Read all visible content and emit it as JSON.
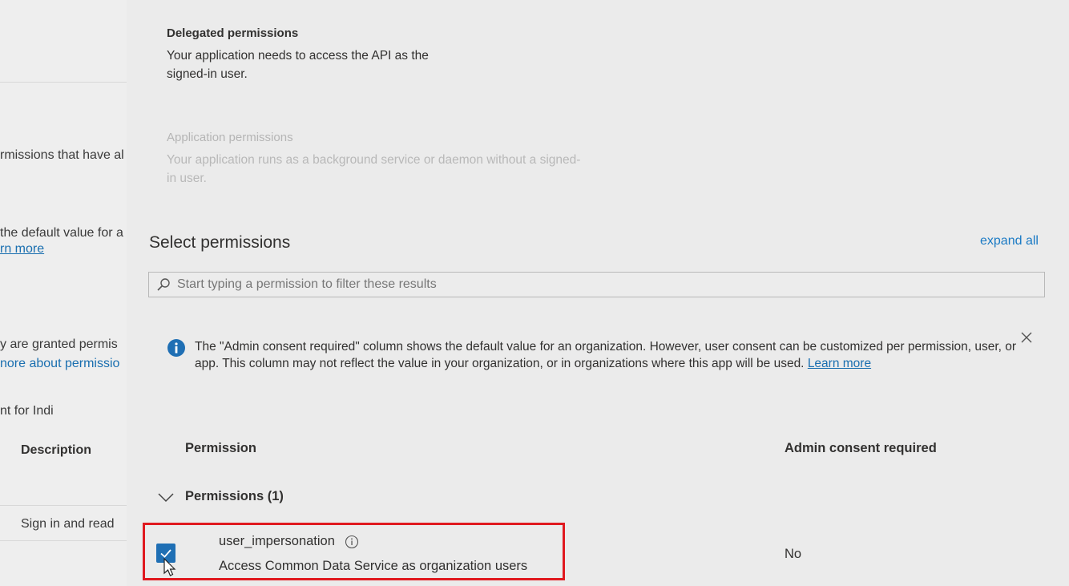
{
  "background_page": {
    "frag_1": "rmissions that have al",
    "frag_2": "the default value for a",
    "frag_3": "rn more",
    "frag_4": "y are granted permis",
    "frag_5": "nore about permissio",
    "frag_6": "nt for Indi",
    "column_description": "Description",
    "row_text": "Sign in and read"
  },
  "permission_types": {
    "delegated": {
      "title": "Delegated permissions",
      "description": "Your application needs to access the API as the signed-in user."
    },
    "application": {
      "title": "Application permissions",
      "description": "Your application runs as a background service or daemon without a signed-in user."
    }
  },
  "select_permissions": {
    "title": "Select permissions",
    "expand_all": "expand all",
    "search_placeholder": "Start typing a permission to filter these results"
  },
  "info_bar": {
    "text": "The \"Admin consent required\" column shows the default value for an organization. However, user consent can be customized per permission, user, or app. This column may not reflect the value in your organization, or in organizations where this app will be used.",
    "link": "Learn more"
  },
  "table": {
    "col_permission": "Permission",
    "col_admin_consent": "Admin consent required",
    "group_label": "Permissions (1)",
    "rows": [
      {
        "name": "user_impersonation",
        "description": "Access Common Data Service as organization users",
        "admin_consent": "No",
        "checked": true
      }
    ]
  },
  "icons": {
    "search": "search-icon",
    "info": "info-icon",
    "close": "close-icon",
    "chevron": "chevron-down-icon",
    "checkmark": "checkmark-icon",
    "cursor": "mouse-cursor-icon"
  },
  "colors": {
    "accent": "#1f6fb4",
    "link": "#1a7ac4",
    "highlight": "#e0191f"
  }
}
